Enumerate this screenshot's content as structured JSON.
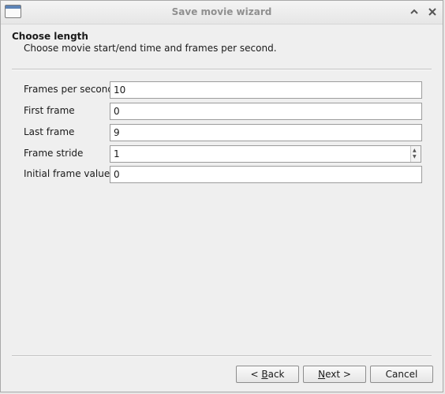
{
  "window": {
    "title": "Save movie wizard"
  },
  "header": {
    "title": "Choose length",
    "subtitle": "Choose movie start/end time and frames per second."
  },
  "fields": [
    {
      "label": "Frames per second",
      "value": "10"
    },
    {
      "label": "First frame",
      "value": "0"
    },
    {
      "label": "Last frame",
      "value": "9"
    },
    {
      "label": "Frame stride",
      "value": "1"
    },
    {
      "label": "Initial frame value",
      "value": "0"
    }
  ],
  "buttons": {
    "back_prefix": "< ",
    "back_mnemonic": "B",
    "back_rest": "ack",
    "next_mnemonic": "N",
    "next_rest": "ext >",
    "cancel": "Cancel"
  },
  "icons": {
    "app": "window-icon",
    "maximize": "chevron-up-icon",
    "close": "close-icon"
  }
}
